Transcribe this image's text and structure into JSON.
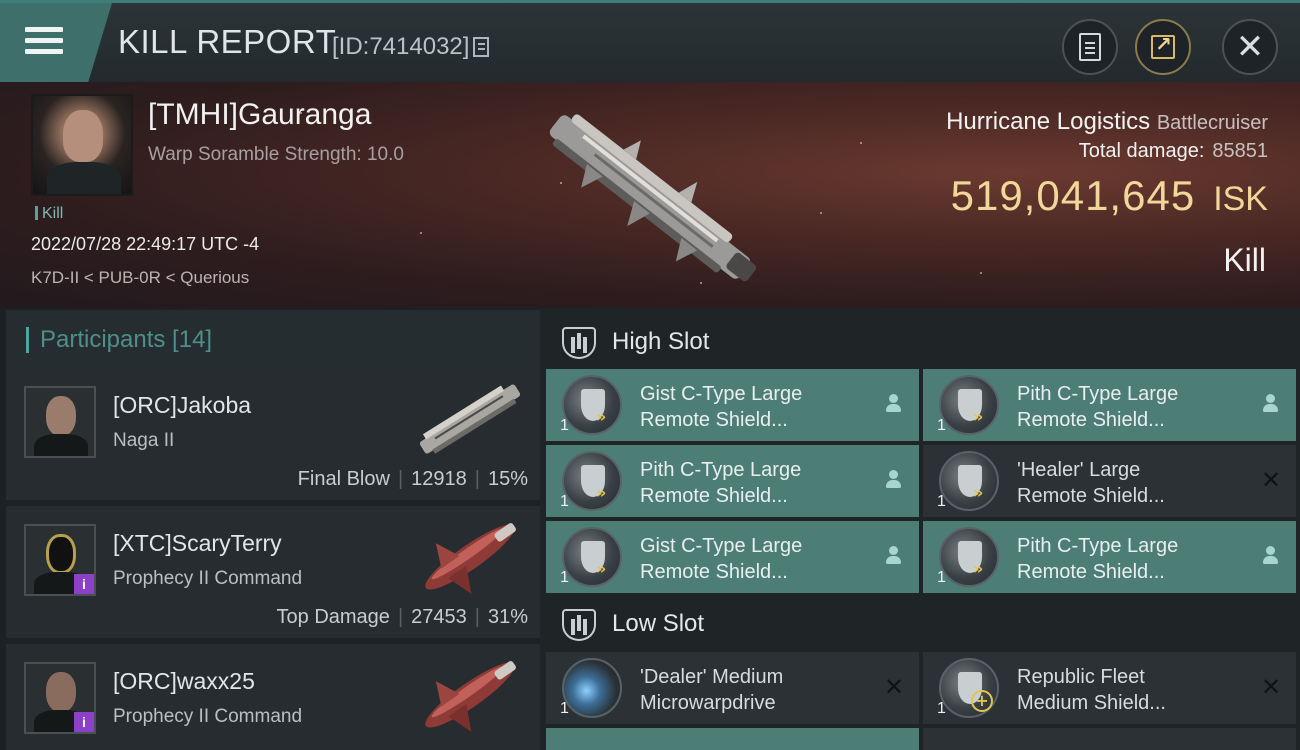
{
  "header": {
    "title": "KILL REPORT",
    "report_id": "[ID:7414032]",
    "icons": {
      "menu": "menu-icon",
      "copy": "copy-icon",
      "report": "report-icon",
      "share": "share-icon",
      "close": "close-icon"
    }
  },
  "victim": {
    "name": "[TMHI]Gauranga",
    "subtitle": "Warp Soramble Strength: 10.0",
    "tag": "Kill",
    "datetime": "2022/07/28 22:49:17 UTC -4",
    "location": "K7D-II < PUB-0R < Querious",
    "ship_name": "Hurricane Logistics",
    "ship_class": "Battlecruiser",
    "total_damage_label": "Total damage:",
    "total_damage": "85851",
    "isk_value": "519,041,645",
    "isk_unit": "ISK",
    "result": "Kill"
  },
  "participants": {
    "title": "Participants [14]",
    "rows": [
      {
        "name": "[ORC]Jakoba",
        "ship": "Naga II",
        "label": "Final Blow",
        "damage": "12918",
        "percent": "15%"
      },
      {
        "name": "[XTC]ScaryTerry",
        "ship": "Prophecy II Command",
        "label": "Top Damage",
        "damage": "27453",
        "percent": "31%"
      },
      {
        "name": "[ORC]waxx25",
        "ship": "Prophecy II Command",
        "label": "",
        "damage": "",
        "percent": ""
      }
    ]
  },
  "slots": {
    "high": {
      "title": "High Slot",
      "items": [
        {
          "qty": "1",
          "line1": "Gist C-Type Large",
          "line2": "Remote Shield...",
          "status": "person"
        },
        {
          "qty": "1",
          "line1": "Pith C-Type Large",
          "line2": "Remote Shield...",
          "status": "person"
        },
        {
          "qty": "1",
          "line1": "Pith C-Type Large",
          "line2": "Remote Shield...",
          "status": "person"
        },
        {
          "qty": "1",
          "line1": "'Healer' Large",
          "line2": "Remote Shield...",
          "status": "x"
        },
        {
          "qty": "1",
          "line1": "Gist C-Type Large",
          "line2": "Remote Shield...",
          "status": "person"
        },
        {
          "qty": "1",
          "line1": "Pith C-Type Large",
          "line2": "Remote Shield...",
          "status": "person"
        }
      ]
    },
    "low": {
      "title": "Low Slot",
      "items": [
        {
          "qty": "1",
          "line1": "'Dealer' Medium",
          "line2": "Microwarpdrive",
          "status": "x"
        },
        {
          "qty": "1",
          "line1": "Republic Fleet",
          "line2": "Medium Shield...",
          "status": "x"
        }
      ]
    }
  }
}
